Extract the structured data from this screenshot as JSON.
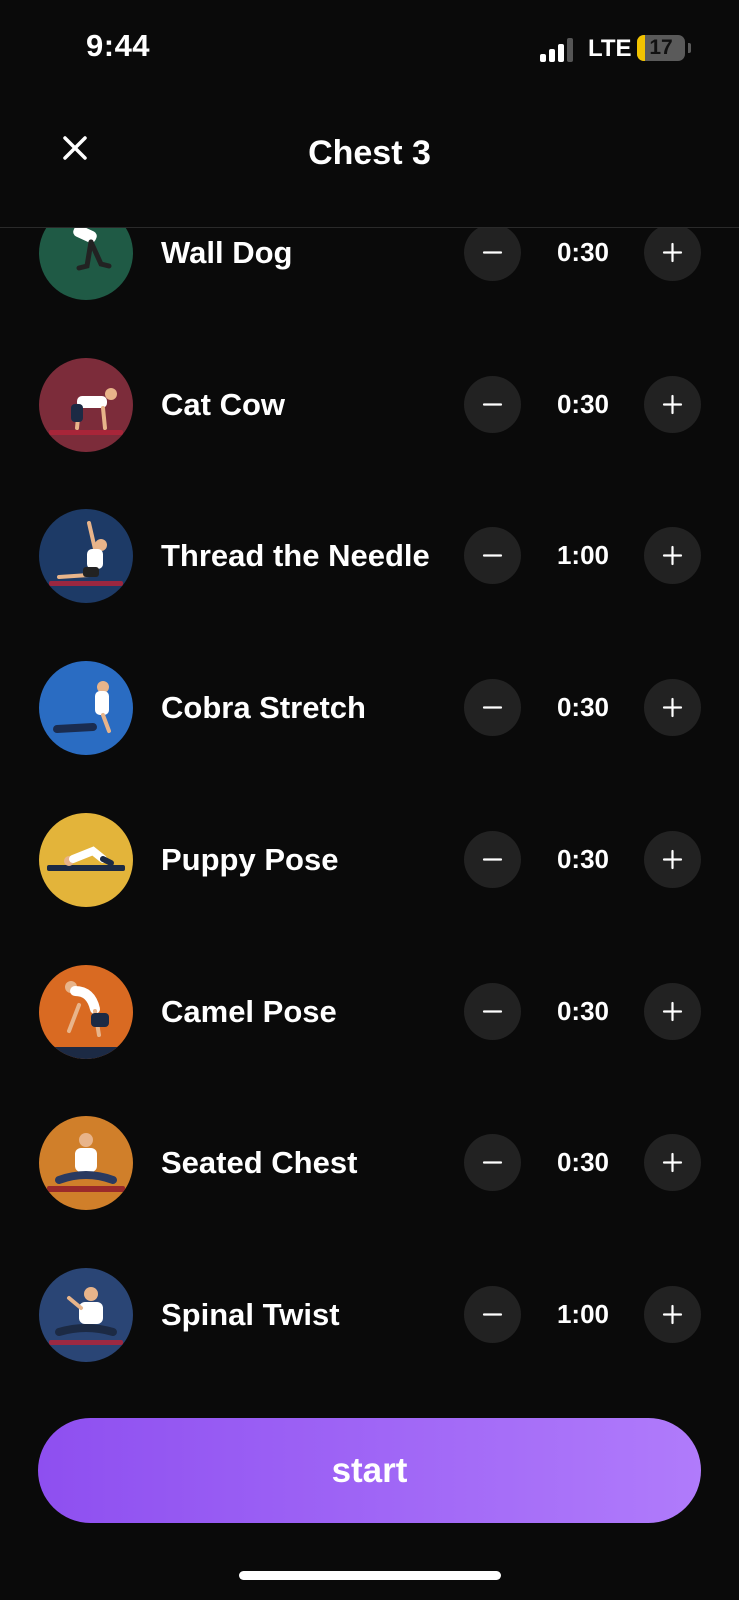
{
  "status_bar": {
    "time": "9:44",
    "network": "LTE",
    "battery_level": "17",
    "battery_fraction": 0.17
  },
  "header": {
    "title": "Chest 3"
  },
  "exercises": [
    {
      "name": "Wall Dog",
      "duration": "0:30",
      "color": "#1f5a45"
    },
    {
      "name": "Cat Cow",
      "duration": "0:30",
      "color": "#7c2c3a"
    },
    {
      "name": "Thread the Needle",
      "duration": "1:00",
      "color": "#1d3a66"
    },
    {
      "name": "Cobra Stretch",
      "duration": "0:30",
      "color": "#2a6cc2"
    },
    {
      "name": "Puppy Pose",
      "duration": "0:30",
      "color": "#e3b43a"
    },
    {
      "name": "Camel Pose",
      "duration": "0:30",
      "color": "#d96a22"
    },
    {
      "name": "Seated Chest",
      "duration": "0:30",
      "color": "#d07f2a"
    },
    {
      "name": "Spinal Twist",
      "duration": "1:00",
      "color": "#2a4575"
    }
  ],
  "footer": {
    "start_label": "start"
  },
  "colors": {
    "background": "#0a0a0a",
    "button_gradient_start": "#8e4ff0",
    "button_gradient_end": "#b07bfb"
  }
}
